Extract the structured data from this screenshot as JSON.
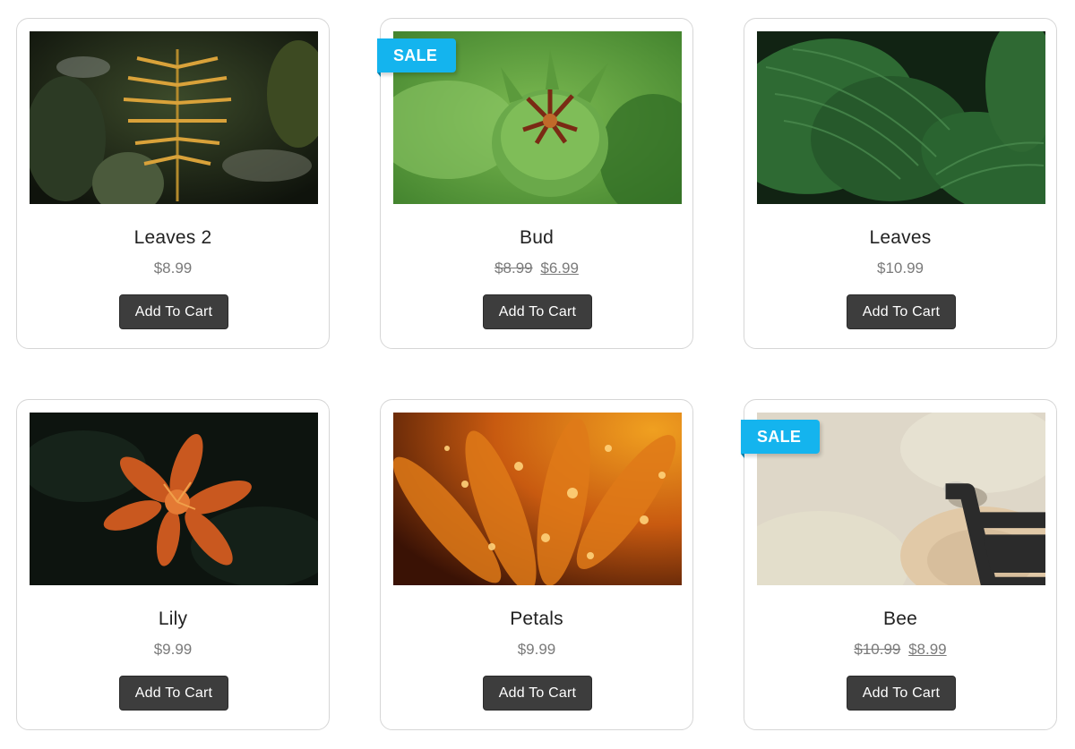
{
  "products": [
    {
      "name": "Leaves 2",
      "price": "$8.99",
      "old_price": "",
      "sale": false,
      "button": "Add To Cart",
      "image": "fern-leaves-image"
    },
    {
      "name": "Bud",
      "price": "$6.99",
      "old_price": "$8.99",
      "sale": true,
      "sale_label": "SALE",
      "button": "Add To Cart",
      "image": "flower-bud-image"
    },
    {
      "name": "Leaves",
      "price": "$10.99",
      "old_price": "",
      "sale": false,
      "button": "Add To Cart",
      "image": "green-leaves-image"
    },
    {
      "name": "Lily",
      "price": "$9.99",
      "old_price": "",
      "sale": false,
      "button": "Add To Cart",
      "image": "lily-image"
    },
    {
      "name": "Petals",
      "price": "$9.99",
      "old_price": "",
      "sale": false,
      "button": "Add To Cart",
      "image": "orange-petals-image"
    },
    {
      "name": "Bee",
      "price": "$8.99",
      "old_price": "$10.99",
      "sale": true,
      "sale_label": "SALE",
      "button": "Add To Cart",
      "image": "bee-flower-image",
      "hover_icon": "shopping-cart-icon"
    }
  ],
  "colors": {
    "sale_badge": "#14b4ee",
    "button_bg": "#3d3d3d",
    "price_text": "#7a7a7a",
    "card_border": "#d6d6d6"
  }
}
